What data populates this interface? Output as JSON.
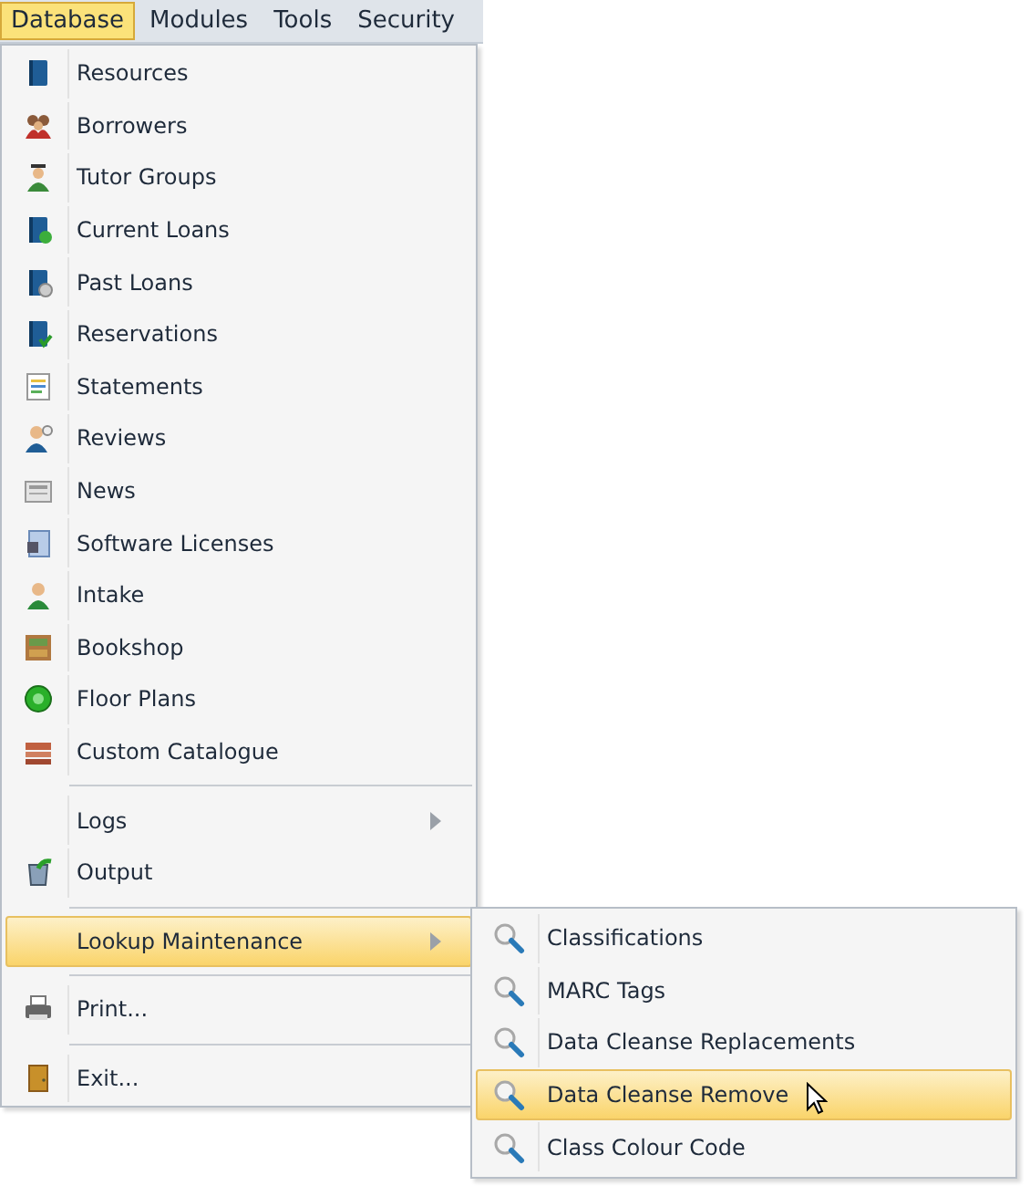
{
  "menu_bar": [
    {
      "label": "Database",
      "selected": true
    },
    {
      "label": "Modules",
      "selected": false
    },
    {
      "label": "Tools",
      "selected": false
    },
    {
      "label": "Security",
      "selected": false
    }
  ],
  "dropdown": {
    "groups": [
      {
        "items": [
          {
            "label": "Resources",
            "selected": false,
            "has_submenu": false
          },
          {
            "label": "Borrowers",
            "selected": false,
            "has_submenu": false
          },
          {
            "label": "Tutor Groups",
            "selected": false,
            "has_submenu": false
          },
          {
            "label": "Current Loans",
            "selected": false,
            "has_submenu": false
          },
          {
            "label": "Past Loans",
            "selected": false,
            "has_submenu": false
          },
          {
            "label": "Reservations",
            "selected": false,
            "has_submenu": false
          },
          {
            "label": "Statements",
            "selected": false,
            "has_submenu": false
          },
          {
            "label": "Reviews",
            "selected": false,
            "has_submenu": false
          },
          {
            "label": "News",
            "selected": false,
            "has_submenu": false
          },
          {
            "label": "Software Licenses",
            "selected": false,
            "has_submenu": false
          },
          {
            "label": "Intake",
            "selected": false,
            "has_submenu": false
          },
          {
            "label": "Bookshop",
            "selected": false,
            "has_submenu": false
          },
          {
            "label": "Floor Plans",
            "selected": false,
            "has_submenu": false
          },
          {
            "label": "Custom Catalogue",
            "selected": false,
            "has_submenu": false
          }
        ]
      },
      {
        "items": [
          {
            "label": "Logs",
            "selected": false,
            "has_submenu": true
          },
          {
            "label": "Output",
            "selected": false,
            "has_submenu": false
          }
        ]
      },
      {
        "items": [
          {
            "label": "Lookup Maintenance",
            "selected": true,
            "has_submenu": true
          }
        ]
      },
      {
        "items": [
          {
            "label": "Print...",
            "selected": false,
            "has_submenu": false
          }
        ]
      },
      {
        "items": [
          {
            "label": "Exit...",
            "selected": false,
            "has_submenu": false
          }
        ]
      }
    ]
  },
  "submenu": {
    "items": [
      {
        "label": "Classifications",
        "selected": false
      },
      {
        "label": "MARC Tags",
        "selected": false
      },
      {
        "label": "Data Cleanse Replacements",
        "selected": false
      },
      {
        "label": "Data Cleanse Remove",
        "selected": true
      },
      {
        "label": "Class Colour Code",
        "selected": false
      }
    ]
  }
}
